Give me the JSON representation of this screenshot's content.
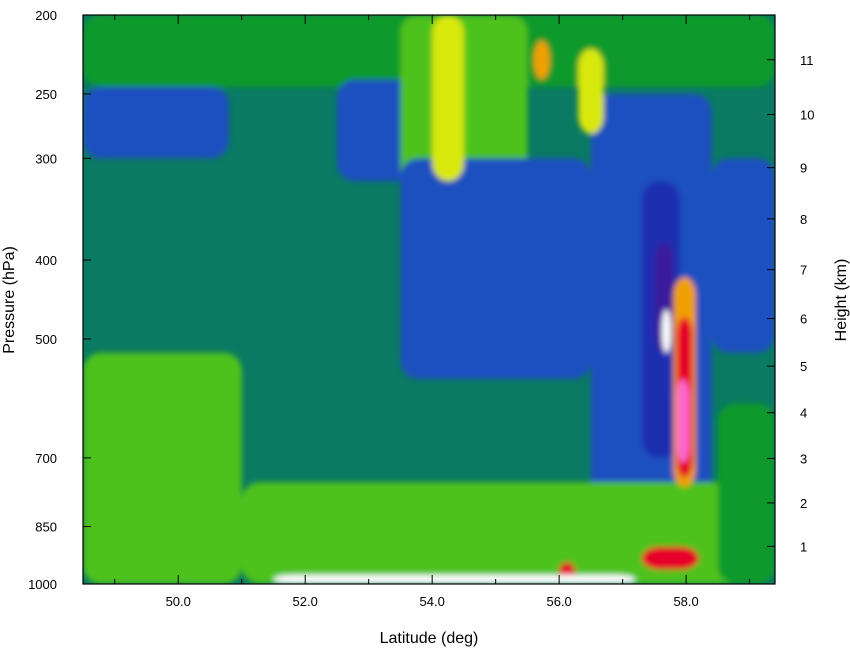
{
  "chart_data": {
    "type": "heatmap",
    "title": "",
    "xlabel": "Latitude (deg)",
    "ylabel_left": "Pressure (hPa)",
    "ylabel_right": "Height (km)",
    "xlim": [
      48.5,
      59.4
    ],
    "ylim_pressure": [
      1000,
      200
    ],
    "y_scale": "log-pressure",
    "x_ticks": [
      50.0,
      52.0,
      54.0,
      56.0,
      58.0
    ],
    "x_tick_labels": [
      "50.0",
      "52.0",
      "54.0",
      "56.0",
      "58.0"
    ],
    "x_minor_ticks": [
      49,
      51,
      53,
      55,
      57,
      59
    ],
    "y_left_ticks": [
      200,
      250,
      300,
      400,
      500,
      700,
      850,
      1000
    ],
    "y_left_tick_labels": [
      "200",
      "250",
      "300",
      "400",
      "500",
      "700",
      "850",
      "1000"
    ],
    "y_right_ticks": [
      {
        "label": "1",
        "pressure": 899
      },
      {
        "label": "2",
        "pressure": 795
      },
      {
        "label": "3",
        "pressure": 701
      },
      {
        "label": "4",
        "pressure": 616
      },
      {
        "label": "5",
        "pressure": 540
      },
      {
        "label": "6",
        "pressure": 472
      },
      {
        "label": "7",
        "pressure": 411
      },
      {
        "label": "8",
        "pressure": 356
      },
      {
        "label": "9",
        "pressure": 308
      },
      {
        "label": "10",
        "pressure": 265
      },
      {
        "label": "11",
        "pressure": 227
      }
    ],
    "grid": false,
    "legend": "none",
    "background_color": "#0a7a62",
    "features": [
      {
        "kind": "fill",
        "color": "#0f9a2a",
        "lat": [
          48.5,
          59.4
        ],
        "p": [
          200,
          245
        ]
      },
      {
        "kind": "fill",
        "color": "#1f50c0",
        "lat": [
          48.5,
          50.8
        ],
        "p": [
          245,
          300
        ]
      },
      {
        "kind": "fill",
        "color": "#1f50c0",
        "lat": [
          52.5,
          54.5
        ],
        "p": [
          240,
          320
        ]
      },
      {
        "kind": "fill",
        "color": "#4ec21a",
        "lat": [
          53.5,
          55.5
        ],
        "p": [
          200,
          330
        ]
      },
      {
        "kind": "fill",
        "color": "#1f50c0",
        "lat": [
          53.5,
          56.5
        ],
        "p": [
          300,
          560
        ]
      },
      {
        "kind": "fill",
        "color": "#1f50c0",
        "lat": [
          56.5,
          58.4
        ],
        "p": [
          250,
          880
        ]
      },
      {
        "kind": "fill",
        "color": "#1f50c0",
        "lat": [
          58.4,
          59.4
        ],
        "p": [
          300,
          520
        ]
      },
      {
        "kind": "fill",
        "color": "#1d2db0",
        "lat": [
          57.3,
          57.9
        ],
        "p": [
          320,
          700
        ]
      },
      {
        "kind": "fill",
        "color": "#3a1c9c",
        "lat": [
          57.5,
          57.8
        ],
        "p": [
          380,
          520
        ]
      },
      {
        "kind": "fill",
        "color": "#ffffff",
        "lat": [
          57.62,
          57.76
        ],
        "p": [
          460,
          520
        ]
      },
      {
        "kind": "fill",
        "color": "#4ec21a",
        "lat": [
          48.5,
          51.0
        ],
        "p": [
          520,
          1000
        ]
      },
      {
        "kind": "fill",
        "color": "#4ec21a",
        "lat": [
          51.0,
          59.4
        ],
        "p": [
          750,
          1000
        ]
      },
      {
        "kind": "fill",
        "color": "#0f9a2a",
        "lat": [
          58.5,
          59.4
        ],
        "p": [
          600,
          1000
        ]
      },
      {
        "kind": "fill",
        "color": "#d8e80a",
        "lat": [
          54.0,
          54.5
        ],
        "p": [
          200,
          320
        ]
      },
      {
        "kind": "fill",
        "color": "#d8e80a",
        "lat": [
          56.3,
          56.7
        ],
        "p": [
          220,
          280
        ]
      },
      {
        "kind": "fill",
        "color": "#f0a000",
        "lat": [
          55.6,
          55.85
        ],
        "p": [
          215,
          240
        ]
      },
      {
        "kind": "fill",
        "color": "#f0a000",
        "lat": [
          57.8,
          58.15
        ],
        "p": [
          420,
          760
        ]
      },
      {
        "kind": "fill",
        "color": "#e6002a",
        "lat": [
          57.85,
          58.1
        ],
        "p": [
          470,
          740
        ]
      },
      {
        "kind": "fill",
        "color": "#ff66cc",
        "lat": [
          57.85,
          58.05
        ],
        "p": [
          560,
          710
        ]
      },
      {
        "kind": "fill",
        "color": "#e6002a",
        "lat": [
          56.0,
          56.25
        ],
        "p": [
          940,
          990
        ]
      },
      {
        "kind": "fill",
        "color": "#e6002a",
        "lat": [
          57.3,
          58.2
        ],
        "p": [
          900,
          960
        ]
      },
      {
        "kind": "fill",
        "color": "#ffffff",
        "lat": [
          51.5,
          57.2
        ],
        "p": [
          975,
          1000
        ]
      }
    ]
  }
}
